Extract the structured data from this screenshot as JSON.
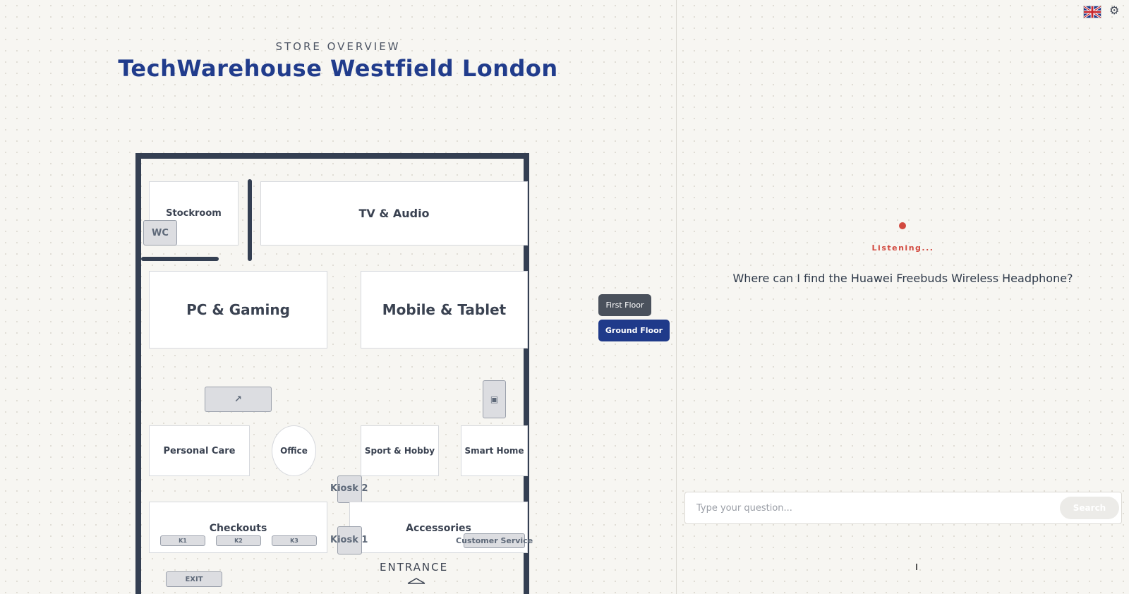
{
  "header": {
    "subtitle": "STORE OVERVIEW",
    "title": "TechWarehouse Westfield London"
  },
  "map": {
    "zones": {
      "stockroom": "Stockroom",
      "wc": "WC",
      "tv_audio": "TV & Audio",
      "pc_gaming": "PC & Gaming",
      "mobile_tablet": "Mobile & Tablet",
      "personal_care": "Personal Care",
      "office": "Office",
      "sport_hobby": "Sport & Hobby",
      "smart_home": "Smart Home",
      "checkouts": "Checkouts",
      "accessories": "Accessories",
      "customer_service": "Customer Service"
    },
    "kiosks": {
      "kiosk1": "Kiosk 1",
      "kiosk2": "Kiosk 2"
    },
    "checkout_counters": [
      "K1",
      "K2",
      "K3"
    ],
    "escalator_glyph": "↗",
    "elevator_glyph": "▣",
    "exit_label": "EXIT",
    "entrance_label": "ENTRANCE"
  },
  "floors": {
    "first": "First Floor",
    "ground": "Ground Floor",
    "active": "Ground Floor",
    "active_color": "#1f3a8a",
    "inactive_color": "#4a515c"
  },
  "assistant": {
    "status": "Listening...",
    "status_color": "#d2493f",
    "question": "Where can I find the Huawei Freebuds Wireless Headphone?",
    "input_placeholder": "Type your question...",
    "search_label": "Search"
  },
  "top_bar": {
    "language_icon": "uk-flag-icon",
    "settings_icon": "gear-icon",
    "settings_glyph": "⚙"
  }
}
